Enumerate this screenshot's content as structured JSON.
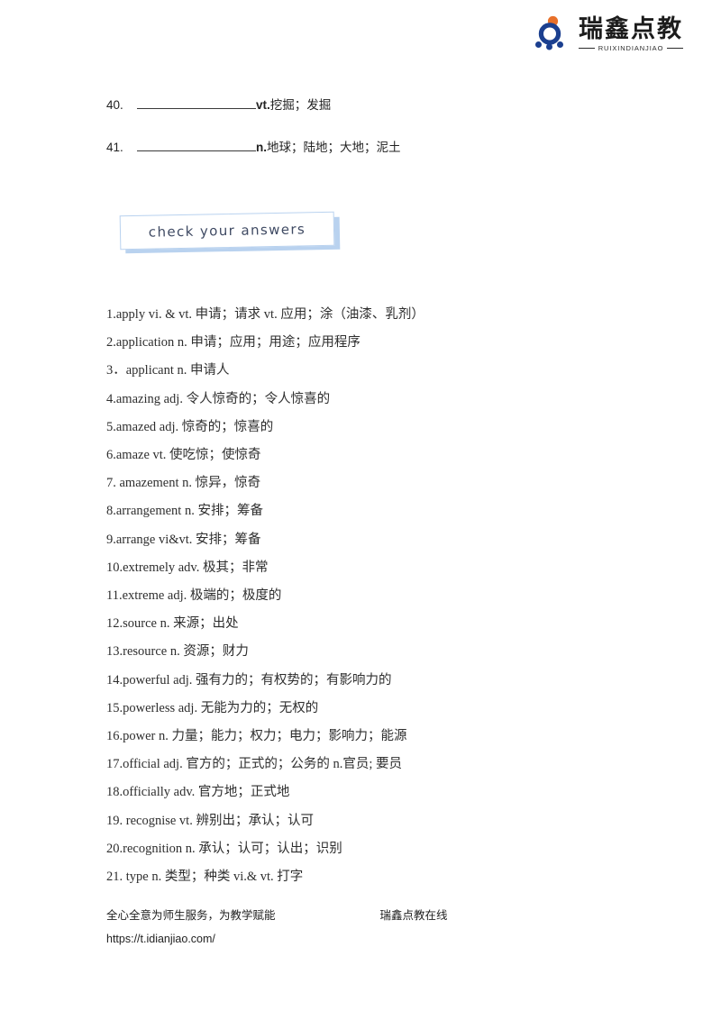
{
  "logo": {
    "cn_name": "瑞鑫点教",
    "pinyin": "RUIXINDIANJIAO",
    "mark_colors": {
      "dot": "#e8702a",
      "ring": "#1b3f8f",
      "small_dots": "#1b3f8f"
    }
  },
  "fill_items": [
    {
      "number": "40.",
      "pos": "vt.",
      "definition": "挖掘；发掘"
    },
    {
      "number": "41.",
      "pos": "n.",
      "definition": "地球；陆地；大地；泥土"
    }
  ],
  "banner": {
    "label": "check your answers",
    "border_color": "#b9d2ef",
    "shadow_color": "#b9d2ef",
    "text_color": "#3f4a63"
  },
  "answers": [
    "1.apply vi. & vt. 申请；请求  vt. 应用；涂（油漆、乳剂）",
    "2.application n. 申请；应用；用途；应用程序",
    "3．applicant n. 申请人",
    "4.amazing adj. 令人惊奇的；令人惊喜的",
    "5.amazed adj. 惊奇的；惊喜的",
    "6.amaze  vt. 使吃惊；使惊奇",
    "7. amazement n. 惊异，惊奇",
    "8.arrangement n. 安排；筹备",
    "9.arrange  vi&vt. 安排；筹备",
    "10.extremely adv. 极其；非常",
    "11.extreme adj. 极端的；极度的",
    "12.source n. 来源；出处",
    "13.resource n. 资源；财力",
    "14.powerful adj. 强有力的；有权势的；有影响力的",
    "15.powerless adj. 无能为力的；无权的",
    "16.power n. 力量；能力；权力；电力；影响力；能源",
    "17.official adj. 官方的；正式的；公务的  n.官员; 要员",
    "18.officially adv. 官方地；正式地",
    "19. recognise    vt. 辨别出；承认；认可",
    "20.recognition n. 承认；认可；认出；识别",
    "21. type n. 类型；种类 vi.& vt. 打字"
  ],
  "footer": {
    "slogan": "全心全意为师生服务，为教学赋能",
    "brand": "瑞鑫点教在线",
    "url": "https://t.idianjiao.com/"
  }
}
